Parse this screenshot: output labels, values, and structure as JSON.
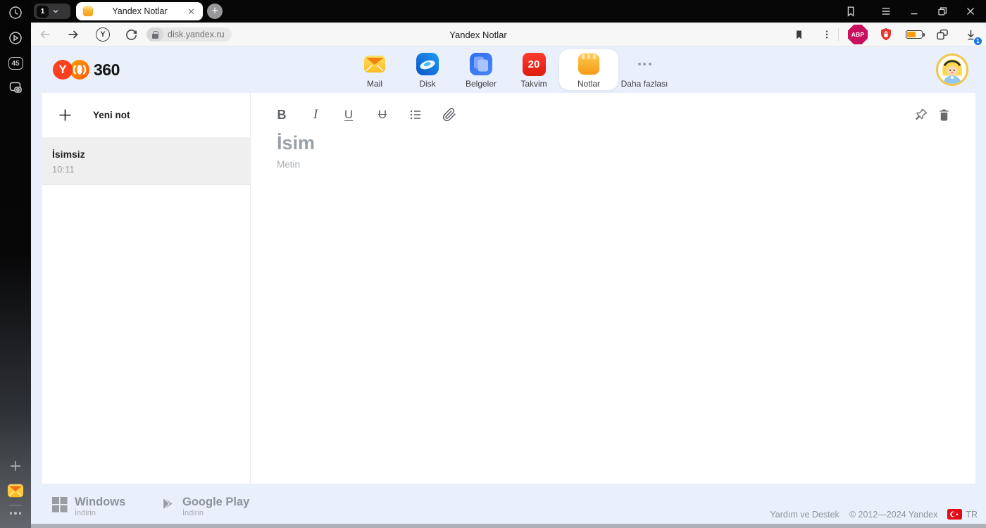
{
  "browser": {
    "sidebar": {
      "badge_45": "45"
    },
    "tabs": {
      "group_count": "1",
      "active_tab_title": "Yandex Notlar"
    },
    "address_bar": {
      "url": "disk.yandex.ru",
      "page_title": "Yandex Notlar"
    },
    "yandex_letter": "Y",
    "extensions": {
      "abp_label": "ABP",
      "download_badge": "1"
    }
  },
  "app": {
    "logo": {
      "letter": "Y",
      "suffix": "360"
    },
    "services": [
      {
        "label": "Mail"
      },
      {
        "label": "Disk"
      },
      {
        "label": "Belgeler"
      },
      {
        "label": "Takvim",
        "badge": "20"
      },
      {
        "label": "Notlar"
      },
      {
        "label": "Daha fazlası"
      }
    ],
    "notes_panel": {
      "new_note": "Yeni not",
      "notes": [
        {
          "title": "İsimsiz",
          "time": "10:11"
        }
      ]
    },
    "editor": {
      "toolbar": {
        "bold": "B",
        "italic": "I",
        "underline": "U",
        "strikethrough": "U"
      },
      "title_placeholder": "İsim",
      "body_placeholder": "Metin"
    },
    "footer": {
      "apps": [
        {
          "name": "Windows",
          "action": "İndirin"
        },
        {
          "name": "Google Play",
          "action": "İndirin"
        }
      ],
      "help": "Yardım ve Destek",
      "copyright": "© 2012—2024 Yandex",
      "locale": "TR"
    }
  },
  "colors": {
    "page_bg": "#e9effb",
    "tabbar_bg": "#070707",
    "accent_orange": "#f9a62b",
    "yandex_red": "#fc3f1d",
    "takvim_red": "#ee2e24",
    "download_badge_blue": "#1a73e8",
    "avatar_ring": "#f1c64b",
    "flag_red": "#e30a17"
  }
}
